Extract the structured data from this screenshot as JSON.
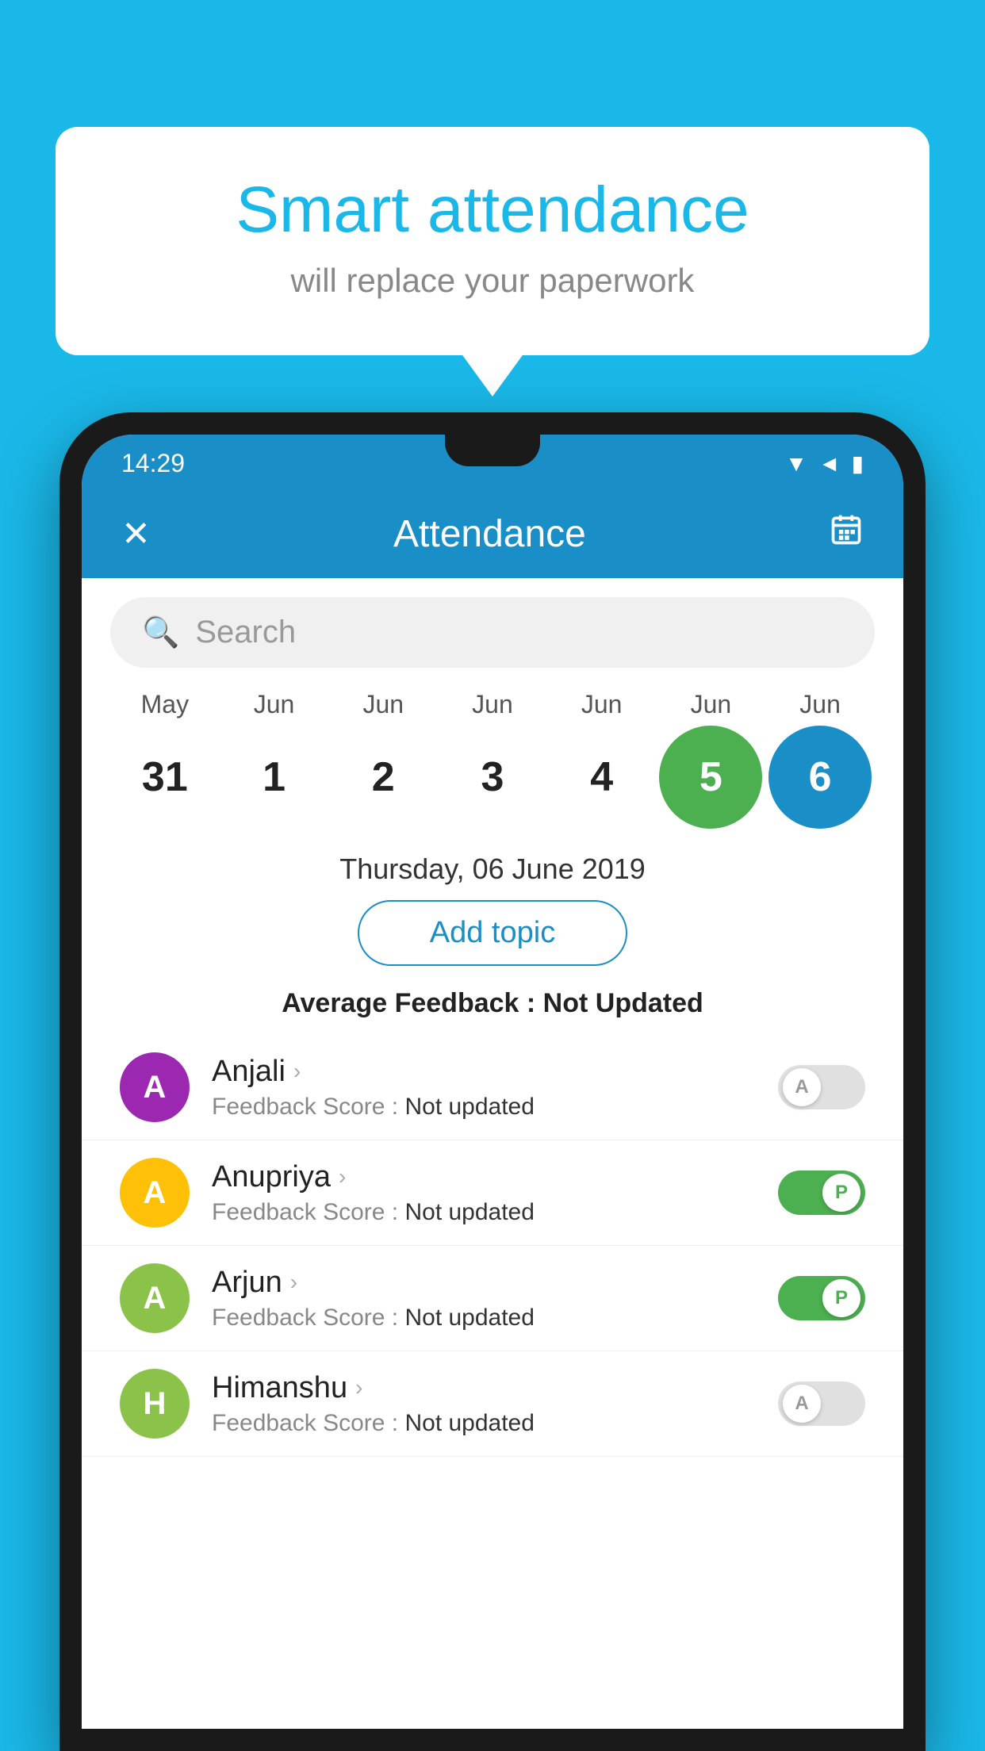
{
  "background": {
    "color": "#1ab8e8"
  },
  "bubble": {
    "title": "Smart attendance",
    "subtitle": "will replace your paperwork"
  },
  "statusBar": {
    "time": "14:29",
    "icons": [
      "wifi",
      "signal",
      "battery"
    ]
  },
  "appBar": {
    "title": "Attendance",
    "closeLabel": "✕",
    "calendarLabel": "📅"
  },
  "search": {
    "placeholder": "Search"
  },
  "calendar": {
    "months": [
      "May",
      "Jun",
      "Jun",
      "Jun",
      "Jun",
      "Jun",
      "Jun"
    ],
    "dates": [
      "31",
      "1",
      "2",
      "3",
      "4",
      "5",
      "6"
    ],
    "todayIndex": 5,
    "selectedIndex": 6
  },
  "selectedDate": "Thursday, 06 June 2019",
  "addTopic": "Add topic",
  "avgFeedback": {
    "label": "Average Feedback : ",
    "value": "Not Updated"
  },
  "students": [
    {
      "name": "Anjali",
      "initial": "A",
      "avatarColor": "#9c27b0",
      "feedback": "Not updated",
      "attendance": "absent"
    },
    {
      "name": "Anupriya",
      "initial": "A",
      "avatarColor": "#ffc107",
      "feedback": "Not updated",
      "attendance": "present"
    },
    {
      "name": "Arjun",
      "initial": "A",
      "avatarColor": "#8bc34a",
      "feedback": "Not updated",
      "attendance": "present"
    },
    {
      "name": "Himanshu",
      "initial": "H",
      "avatarColor": "#8bc34a",
      "feedback": "Not updated",
      "attendance": "absent"
    }
  ],
  "labels": {
    "feedbackScore": "Feedback Score : ",
    "notUpdated": "Not updated",
    "presentLetter": "P",
    "absentLetter": "A"
  }
}
